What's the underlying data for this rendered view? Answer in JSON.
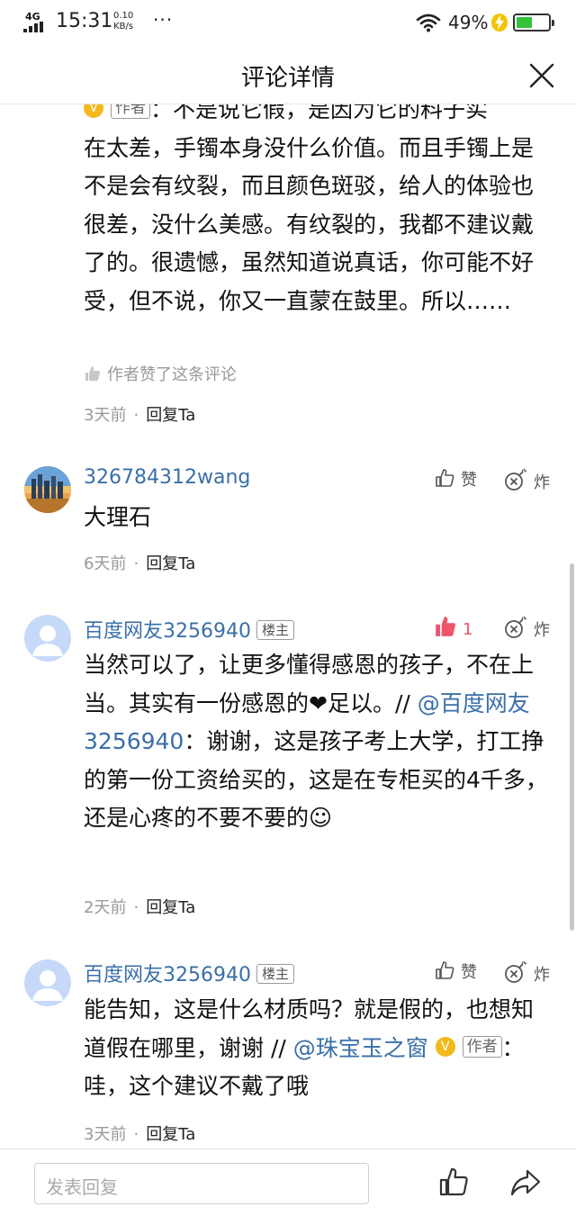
{
  "status_bar": {
    "network": "4G",
    "time": "15:31",
    "speed_value": "0.10",
    "speed_unit": "KB/s",
    "more": "···",
    "battery_percent": "49%",
    "battery_level": 0.49,
    "battery_color": "#33c23a"
  },
  "header": {
    "title": "评论详情"
  },
  "comments": [
    {
      "author_tag": "作者",
      "text_tail": "在太差，手镯本身没什么价值。而且手镯上是不是会有纹裂，而且颜色斑驳，给人的体验也很差，没什么美感。有纹裂的，我都不建议戴了的。很遗憾，虽然知道说真话，你可能不好受，但不说，你又一直蒙在鼓里。所以……",
      "text_head_partial": "：不是说它假，是因为它的料子实",
      "author_liked": "作者赞了这条评论",
      "time": "3天前",
      "reply": "回复Ta"
    },
    {
      "username": "326784312wang",
      "like_label": "赞",
      "bomb_label": "炸",
      "text": "大理石",
      "time": "6天前",
      "reply": "回复Ta"
    },
    {
      "username": "百度网友3256940",
      "floor_tag": "楼主",
      "like_count": "1",
      "liked": true,
      "bomb_label": "炸",
      "text_part1": "当然可以了，让更多懂得感恩的孩子，不在上当。其实有一份感恩的❤足以。// ",
      "mention": "@百度网友3256940",
      "text_part2": "：谢谢，这是孩子考上大学，打工挣的第一份工资给买的，这是在专柜买的4千多，还是心疼的不要不要的☺",
      "time": "2天前",
      "reply": "回复Ta"
    },
    {
      "username": "百度网友3256940",
      "floor_tag": "楼主",
      "like_label": "赞",
      "bomb_label": "炸",
      "text_part1": "能告知，这是什么材质吗？就是假的，也想知道假在哪里，谢谢 // ",
      "mention": "@珠宝玉之窗",
      "badge": "V",
      "author_tag": "作者",
      "text_part2": "：哇，这个建议不戴了哦",
      "time": "3天前",
      "reply": "回复Ta"
    }
  ],
  "bottom_bar": {
    "input_placeholder": "发表回复",
    "icons": [
      "thumbs-up-icon",
      "share-icon"
    ]
  },
  "colors": {
    "link": "#3a6fa8",
    "liked": "#f0546a",
    "badge": "#f3b91c"
  }
}
